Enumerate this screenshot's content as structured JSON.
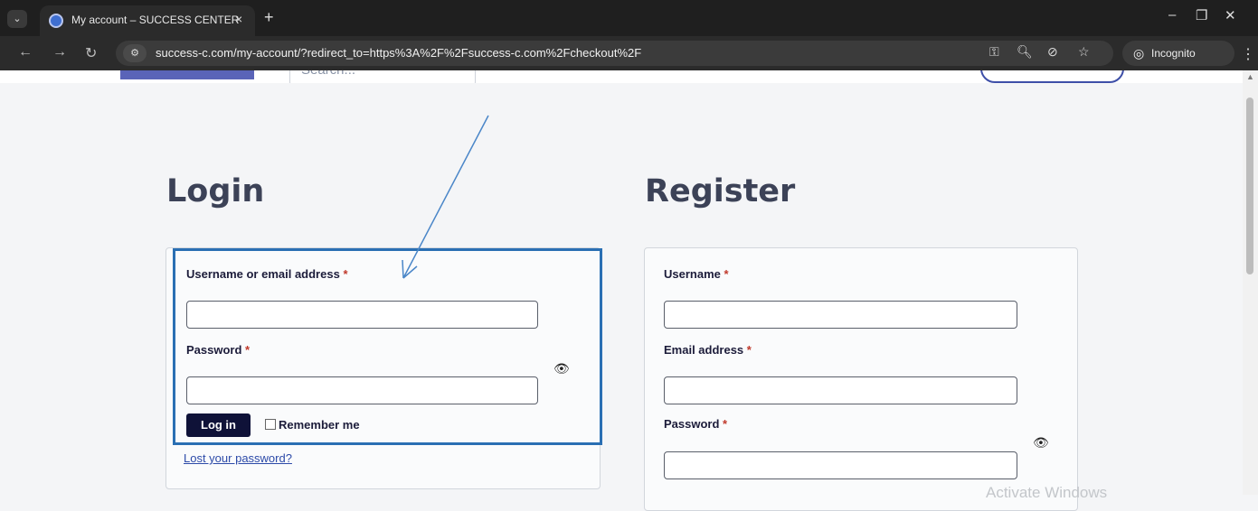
{
  "browser": {
    "tab_title": "My account – SUCCESS CENTER",
    "tab_close": "×",
    "new_tab": "+",
    "url": "success-c.com/my-account/?redirect_to=https%3A%2F%2Fsuccess-c.com%2Fcheckout%2F",
    "incognito_label": "Incognito",
    "window_controls": [
      "–",
      "❐",
      "✕"
    ]
  },
  "site_header": {
    "search_placeholder": "Search..."
  },
  "login": {
    "heading": "Login",
    "username_label": "Username or email address",
    "password_label": "Password",
    "required_mark": "*",
    "button": "Log in",
    "remember_label": "Remember me",
    "lost_password": "Lost your password?"
  },
  "register": {
    "heading": "Register",
    "username_label": "Username",
    "email_label": "Email address",
    "password_label": "Password",
    "required_mark": "*"
  },
  "overlay": {
    "watermark": "Activate Windows",
    "annotation_color": "#2a6fb3"
  }
}
